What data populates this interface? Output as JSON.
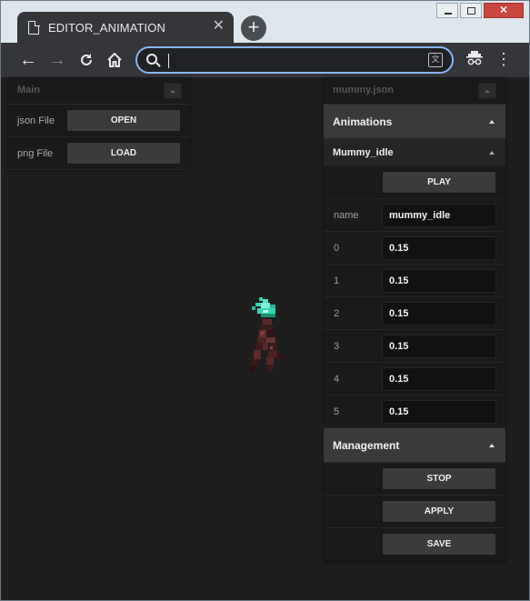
{
  "browser": {
    "tab_title": "EDITOR_ANIMATION",
    "tab_close": "✕",
    "new_tab": "+",
    "address_value": "",
    "icons": {
      "back": "arrow-left-icon",
      "forward": "arrow-right-icon",
      "reload": "reload-icon",
      "home": "home-icon",
      "search": "search-icon",
      "translate": "translate-icon",
      "incognito": "incognito-icon",
      "menu": "more-vert-icon"
    }
  },
  "left_panel": {
    "title": "Main",
    "rows": [
      {
        "label": "json File",
        "button": "OPEN"
      },
      {
        "label": "png File",
        "button": "LOAD"
      }
    ]
  },
  "right_panel": {
    "title": "mummy.json",
    "animations": {
      "title": "Animations",
      "animation": {
        "name": "Mummy_idle",
        "play_label": "PLAY",
        "name_label": "name",
        "name_value": "mummy_idle",
        "frames": [
          {
            "index": "0",
            "value": "0.15"
          },
          {
            "index": "1",
            "value": "0.15"
          },
          {
            "index": "2",
            "value": "0.15"
          },
          {
            "index": "3",
            "value": "0.15"
          },
          {
            "index": "4",
            "value": "0.15"
          },
          {
            "index": "5",
            "value": "0.15"
          }
        ]
      }
    },
    "management": {
      "title": "Management",
      "stop_label": "STOP",
      "apply_label": "APPLY",
      "save_label": "SAVE"
    }
  },
  "colors": {
    "canvas_bg": "#1e1e1e",
    "panel_bg": "#1a1a1a",
    "section_bg": "#3a3a3a",
    "accent_focus": "#8ab4f8",
    "sprite_glow": "#35d6b0"
  }
}
